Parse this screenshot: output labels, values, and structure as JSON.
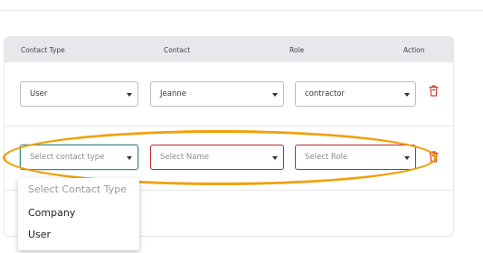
{
  "table": {
    "headers": {
      "contact_type": "Contact Type",
      "contact": "Contact",
      "role": "Role",
      "action": "Action"
    },
    "row1": {
      "contact_type": "User",
      "contact": "Jeanne",
      "role": "contractor"
    },
    "row2": {
      "contact_type_placeholder": "Select contact type",
      "contact_placeholder": "Select Name",
      "role_placeholder": "Select Role"
    }
  },
  "dropdown": {
    "header": "Select Contact Type",
    "options": [
      "Company",
      "User"
    ]
  },
  "colors": {
    "accent": "#f2a007",
    "error": "#c0272d",
    "active_border": "#3a8a8a",
    "header_bg": "#e6e8ec",
    "trash": "#d6392f"
  },
  "icons": {
    "trash": "trash-icon",
    "caret": "chevron-down-icon"
  }
}
